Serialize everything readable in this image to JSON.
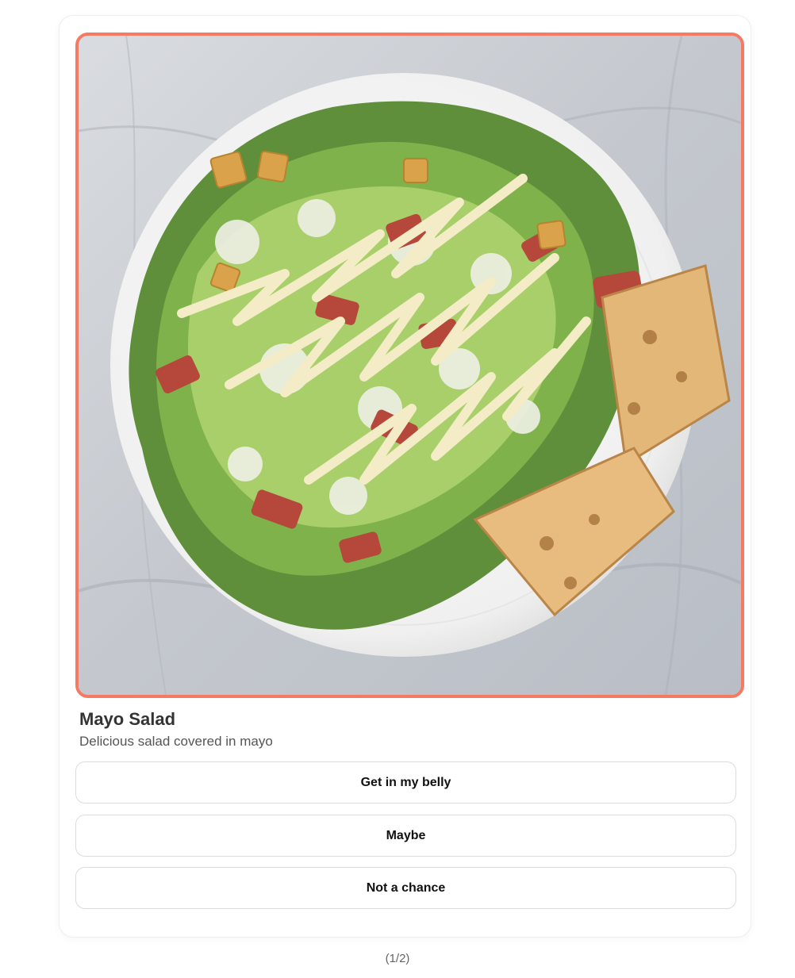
{
  "card": {
    "image": {
      "alt": "Caesar-style salad on a white plate",
      "frame_color": "#f47a63"
    },
    "title": "Mayo Salad",
    "description": "Delicious salad covered in mayo",
    "options": [
      {
        "label": "Get in my belly"
      },
      {
        "label": "Maybe"
      },
      {
        "label": "Not a chance"
      }
    ]
  },
  "pager": {
    "text": "(1/2)"
  }
}
